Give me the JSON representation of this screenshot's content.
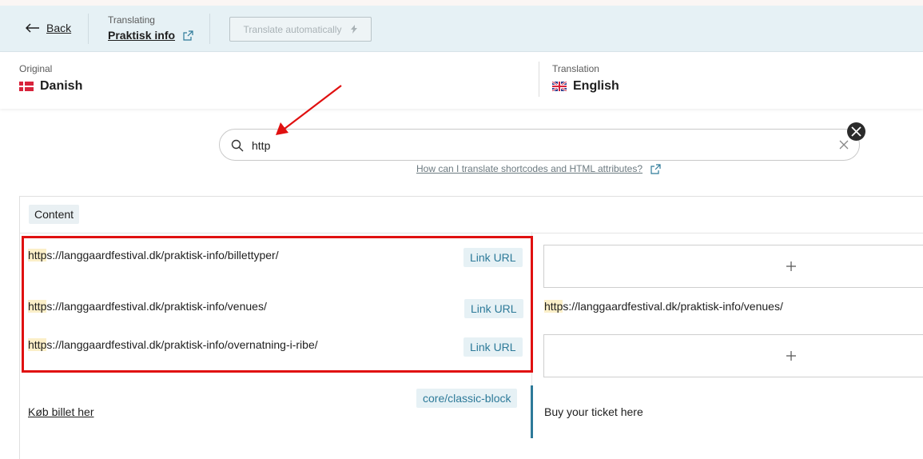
{
  "header": {
    "back_label": "Back",
    "translating_label": "Translating",
    "page_title": "Praktisk info",
    "auto_translate_label": "Translate automatically"
  },
  "languages": {
    "original_label": "Original",
    "original_name": "Danish",
    "translation_label": "Translation",
    "translation_name": "English"
  },
  "search": {
    "value": "http",
    "help_link": "How can I translate shortcodes and HTML attributes?"
  },
  "panel": {
    "section_tag": "Content",
    "rows": [
      {
        "highlight": "http",
        "rest": "s://langgaardfestival.dk/praktisk-info/billettyper/",
        "type": "Link URL",
        "translation": ""
      },
      {
        "highlight": "http",
        "rest": "s://langgaardfestival.dk/praktisk-info/venues/",
        "type": "Link URL",
        "translation_highlight": "http",
        "translation_rest": "s://langgaardfestival.dk/praktisk-info/venues/"
      },
      {
        "highlight": "http",
        "rest": "s://langgaardfestival.dk/praktisk-info/overnatning-i-ribe/",
        "type": "Link URL",
        "translation": ""
      },
      {
        "text": "Køb billet her",
        "type": "core/classic-block",
        "translation": "Buy your ticket here"
      }
    ]
  },
  "colors": {
    "header_bg": "#e6f1f5",
    "accent": "#2d7a99",
    "highlight": "#fbefc8",
    "annotation_red": "#e01010"
  }
}
